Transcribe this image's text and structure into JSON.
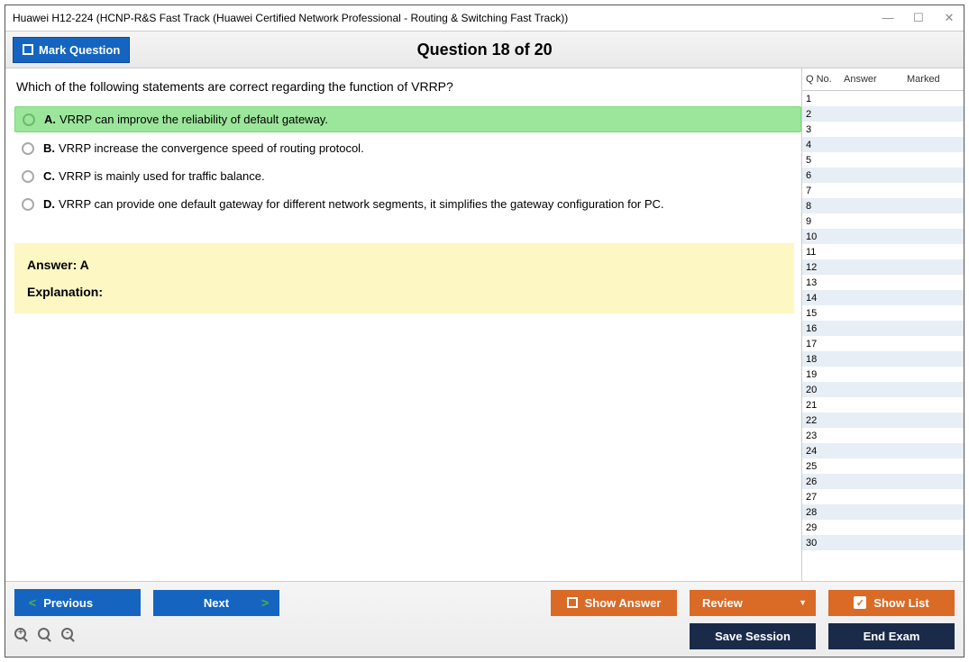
{
  "window": {
    "title": "Huawei H12-224 (HCNP-R&S Fast Track (Huawei Certified Network Professional - Routing & Switching Fast Track))"
  },
  "header": {
    "mark_label": "Mark Question",
    "question_title": "Question 18 of 20"
  },
  "question": {
    "text": "Which of the following statements are correct regarding the function of VRRP?",
    "options": [
      {
        "letter": "A.",
        "text": "VRRP can improve the reliability of default gateway.",
        "correct": true
      },
      {
        "letter": "B.",
        "text": "VRRP increase the convergence speed of routing protocol.",
        "correct": false
      },
      {
        "letter": "C.",
        "text": "VRRP is mainly used for traffic balance.",
        "correct": false
      },
      {
        "letter": "D.",
        "text": "VRRP can provide one default gateway for different network segments, it simplifies the gateway configuration for PC.",
        "correct": false
      }
    ],
    "answer_label": "Answer: A",
    "explanation_label": "Explanation:"
  },
  "sidebar": {
    "headers": {
      "qno": "Q No.",
      "answer": "Answer",
      "marked": "Marked"
    },
    "rows": [
      1,
      2,
      3,
      4,
      5,
      6,
      7,
      8,
      9,
      10,
      11,
      12,
      13,
      14,
      15,
      16,
      17,
      18,
      19,
      20,
      21,
      22,
      23,
      24,
      25,
      26,
      27,
      28,
      29,
      30
    ]
  },
  "footer": {
    "previous": "Previous",
    "next": "Next",
    "show_answer": "Show Answer",
    "review": "Review",
    "show_list": "Show List",
    "save_session": "Save Session",
    "end_exam": "End Exam"
  }
}
